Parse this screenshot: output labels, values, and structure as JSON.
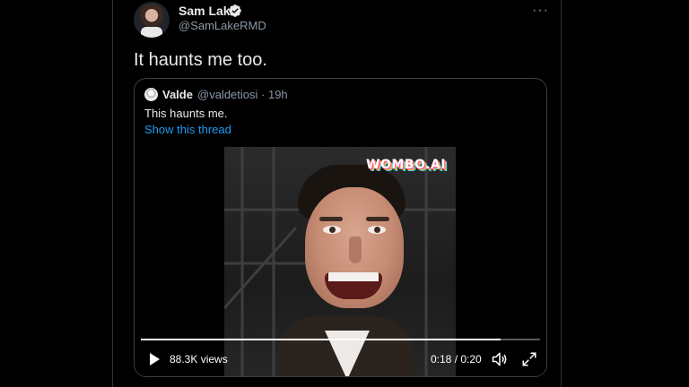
{
  "tweet": {
    "author_name": "Sam Lake",
    "author_handle": "@SamLakeRMD",
    "text": "It haunts me too.",
    "verified_icon": "verified-badge-icon",
    "more_icon": "more-options-icon",
    "more_label": "···"
  },
  "quoted": {
    "author_name": "Valde",
    "author_handle": "@valdetiosi",
    "time": "· 19h",
    "text": "This haunts me.",
    "link": "Show this thread"
  },
  "video": {
    "watermark": "WOMBO.AI",
    "views": "88.3K views",
    "time": "0:18 / 0:20",
    "progress": 0.9,
    "play_icon": "play-icon",
    "volume_icon": "volume-icon",
    "fullscreen_icon": "fullscreen-icon"
  },
  "colors": {
    "background": "#000000",
    "link": "#1d9bf0",
    "secondary_text": "#8b98a5"
  }
}
